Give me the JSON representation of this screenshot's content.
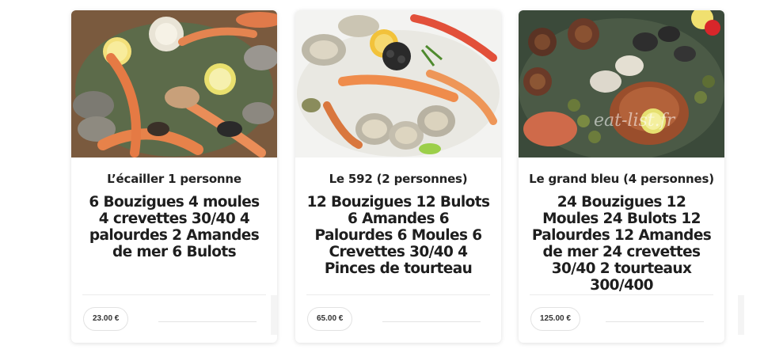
{
  "cards": [
    {
      "title": "L’écailler 1 personne",
      "description": "6 Bouzigues 4 moules 4 crevettes 30/40 4 palourdes 2 Amandes de mer 6 Bulots",
      "price": "23.00 €",
      "image": "seafood-platter-photo"
    },
    {
      "title": "Le 592 (2 personnes)",
      "description": "12 Bouzigues 12 Bulots 6 Amandes 6 Palourdes 6 Moules 6 Crevettes 30/40 4 Pinces de tourteau",
      "price": "65.00 €",
      "image": "seafood-platter-photo"
    },
    {
      "title": "Le grand bleu (4 personnes)",
      "description": "24 Bouzigues 12 Moules 24 Bulots 12 Palourdes 12 Amandes de mer 24 crevettes 30/40 2 tourteaux 300/400",
      "price": "125.00 €",
      "image": "seafood-platter-photo"
    }
  ],
  "watermark": "eat-list.fr",
  "colors": {
    "card_bg": "#ffffff",
    "text": "#222222",
    "pill_border": "#e2e2e2"
  }
}
